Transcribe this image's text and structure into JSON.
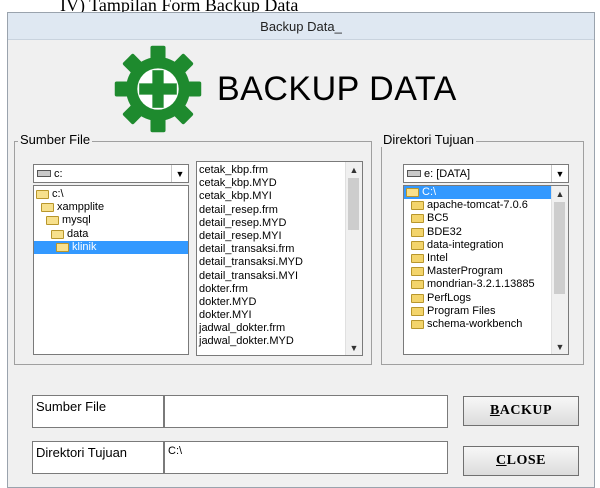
{
  "caption": "IV) Tampilan Form Backup Data",
  "window": {
    "title": "Backup Data_"
  },
  "banner": {
    "text": "BACKUP DATA",
    "icon": "gear-plus-icon",
    "accent": "#1e8a2e"
  },
  "sumber": {
    "legend": "Sumber File",
    "drive": "c:",
    "folders": [
      {
        "label": "c:\\",
        "level": 0,
        "selected": false
      },
      {
        "label": "xampplite",
        "level": 1,
        "selected": false
      },
      {
        "label": "mysql",
        "level": 2,
        "selected": false
      },
      {
        "label": "data",
        "level": 3,
        "selected": false
      },
      {
        "label": "klinik",
        "level": 4,
        "selected": true
      }
    ],
    "files": [
      "cetak_kbp.frm",
      "cetak_kbp.MYD",
      "cetak_kbp.MYI",
      "detail_resep.frm",
      "detail_resep.MYD",
      "detail_resep.MYI",
      "detail_transaksi.frm",
      "detail_transaksi.MYD",
      "detail_transaksi.MYI",
      "dokter.frm",
      "dokter.MYD",
      "dokter.MYI",
      "jadwal_dokter.frm",
      "jadwal_dokter.MYD"
    ]
  },
  "tujuan": {
    "legend": "Direktori Tujuan",
    "drive": "e: [DATA]",
    "root": "C:\\",
    "folders": [
      "apache-tomcat-7.0.6",
      "BC5",
      "BDE32",
      "data-integration",
      "Intel",
      "MasterProgram",
      "mondrian-3.2.1.13885",
      "PerfLogs",
      "Program Files",
      "schema-workbench"
    ]
  },
  "form": {
    "sumber_label": "Sumber File",
    "sumber_value": "",
    "tujuan_label": "Direktori Tujuan",
    "tujuan_value": "C:\\",
    "backup_first": "B",
    "backup_rest": "ACKUP",
    "close_first": "C",
    "close_rest": "LOSE"
  },
  "colors": {
    "selection": "#3399ff",
    "window_bg": "#f0f0f0"
  }
}
